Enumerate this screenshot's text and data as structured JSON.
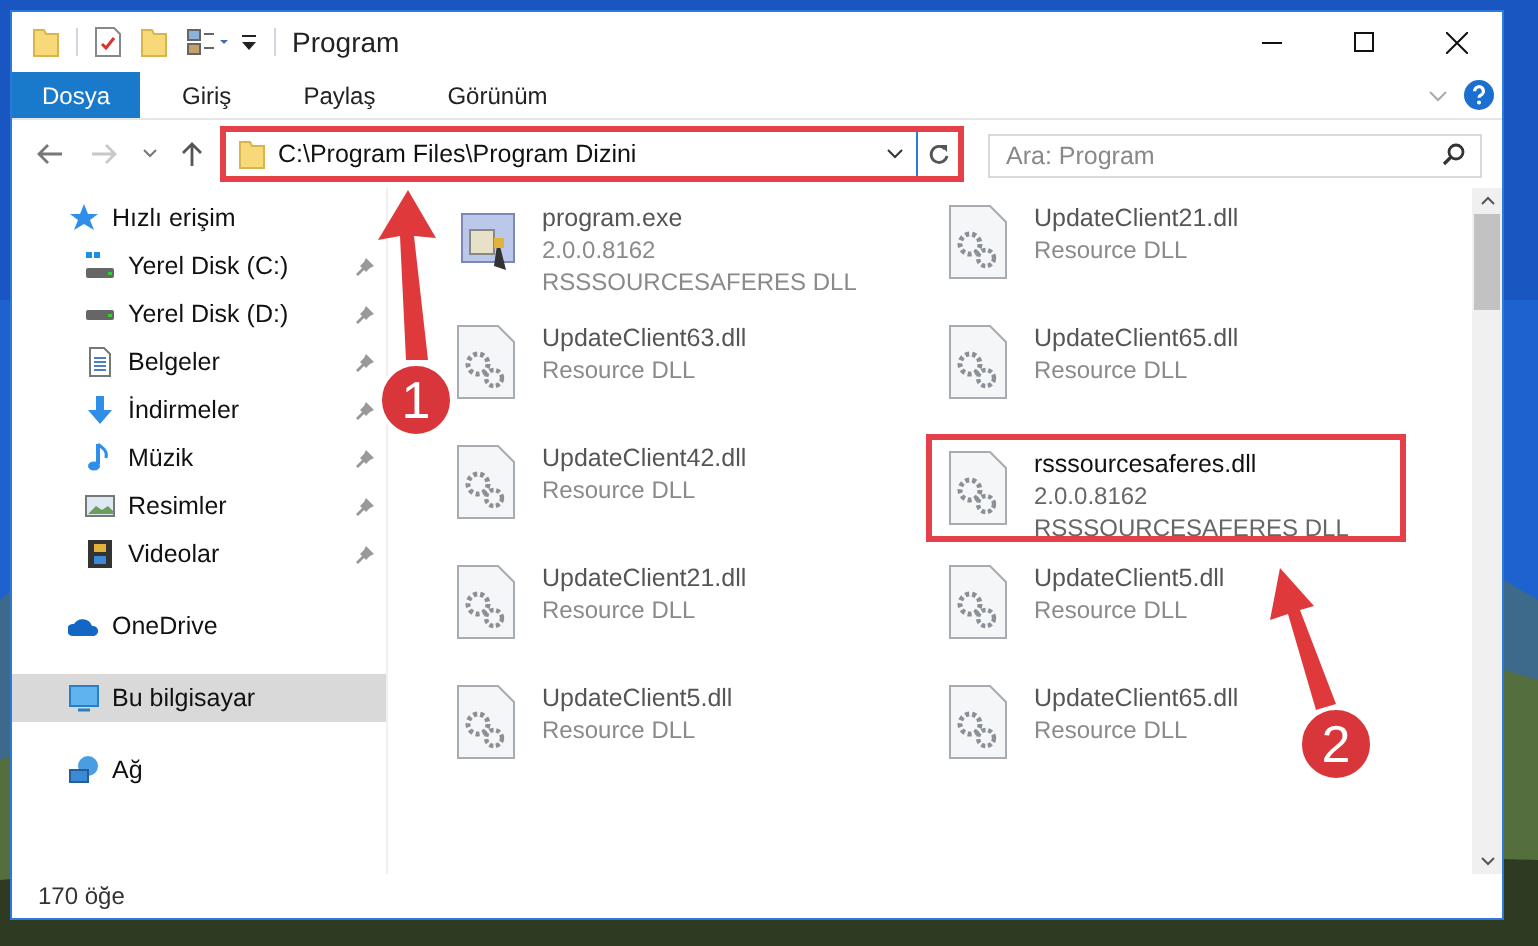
{
  "window": {
    "title": "Program"
  },
  "ribbon_tabs": [
    {
      "label": "Dosya",
      "selected": true
    },
    {
      "label": "Giriş",
      "selected": false
    },
    {
      "label": "Paylaş",
      "selected": false
    },
    {
      "label": "Görünüm",
      "selected": false
    }
  ],
  "address": {
    "path": "C:\\Program Files\\Program Dizini",
    "highlighted": true
  },
  "search": {
    "placeholder": "Ara: Program"
  },
  "sidebar": {
    "items": [
      {
        "label": "Hızlı erişim",
        "kind": "star",
        "selected": false,
        "children": [
          {
            "label": "Yerel Disk (C:)",
            "kind": "system-drive",
            "pinned": true,
            "selected": false
          },
          {
            "label": "Yerel Disk (D:)",
            "kind": "drive",
            "pinned": true,
            "selected": false
          },
          {
            "label": "Belgeler",
            "kind": "document",
            "pinned": true,
            "selected": false
          },
          {
            "label": "İndirmeler",
            "kind": "download",
            "pinned": true,
            "selected": false
          },
          {
            "label": "Müzik",
            "kind": "music",
            "pinned": true,
            "selected": false
          },
          {
            "label": "Resimler",
            "kind": "pictures",
            "pinned": true,
            "selected": false
          },
          {
            "label": "Videolar",
            "kind": "video",
            "pinned": true,
            "selected": false
          }
        ]
      },
      {
        "label": "OneDrive",
        "kind": "cloud",
        "selected": false
      },
      {
        "label": "Bu bilgisayar",
        "kind": "computer",
        "selected": true
      },
      {
        "label": "Ağ",
        "kind": "network",
        "selected": false
      }
    ]
  },
  "files": [
    {
      "name": "program.exe",
      "lines": [
        "2.0.0.8162",
        "RSSSOURCESAFERES DLL"
      ],
      "kind": "exe",
      "blurred": true,
      "highlighted": false
    },
    {
      "name": "UpdateClient21.dll",
      "lines": [
        "Resource DLL"
      ],
      "kind": "dll",
      "blurred": true,
      "highlighted": false
    },
    {
      "name": "UpdateClient63.dll",
      "lines": [
        "Resource DLL"
      ],
      "kind": "dll",
      "blurred": true,
      "highlighted": false
    },
    {
      "name": "UpdateClient65.dll",
      "lines": [
        "Resource DLL"
      ],
      "kind": "dll",
      "blurred": true,
      "highlighted": false
    },
    {
      "name": "UpdateClient42.dll",
      "lines": [
        "Resource DLL"
      ],
      "kind": "dll",
      "blurred": true,
      "highlighted": false
    },
    {
      "name": "rsssourcesaferes.dll",
      "lines": [
        "2.0.0.8162",
        "RSSSOURCESAFERES DLL"
      ],
      "kind": "dll",
      "blurred": false,
      "highlighted": true
    },
    {
      "name": "UpdateClient21.dll",
      "lines": [
        "Resource DLL"
      ],
      "kind": "dll",
      "blurred": true,
      "highlighted": false
    },
    {
      "name": "UpdateClient5.dll",
      "lines": [
        "Resource DLL"
      ],
      "kind": "dll",
      "blurred": true,
      "highlighted": false
    },
    {
      "name": "UpdateClient5.dll",
      "lines": [
        "Resource DLL"
      ],
      "kind": "dll",
      "blurred": true,
      "highlighted": false
    },
    {
      "name": "UpdateClient65.dll",
      "lines": [
        "Resource DLL"
      ],
      "kind": "dll",
      "blurred": true,
      "highlighted": false
    }
  ],
  "status_bar": {
    "item_count": "170 öğe"
  },
  "annotations": [
    {
      "label": "1"
    },
    {
      "label": "2"
    }
  ]
}
